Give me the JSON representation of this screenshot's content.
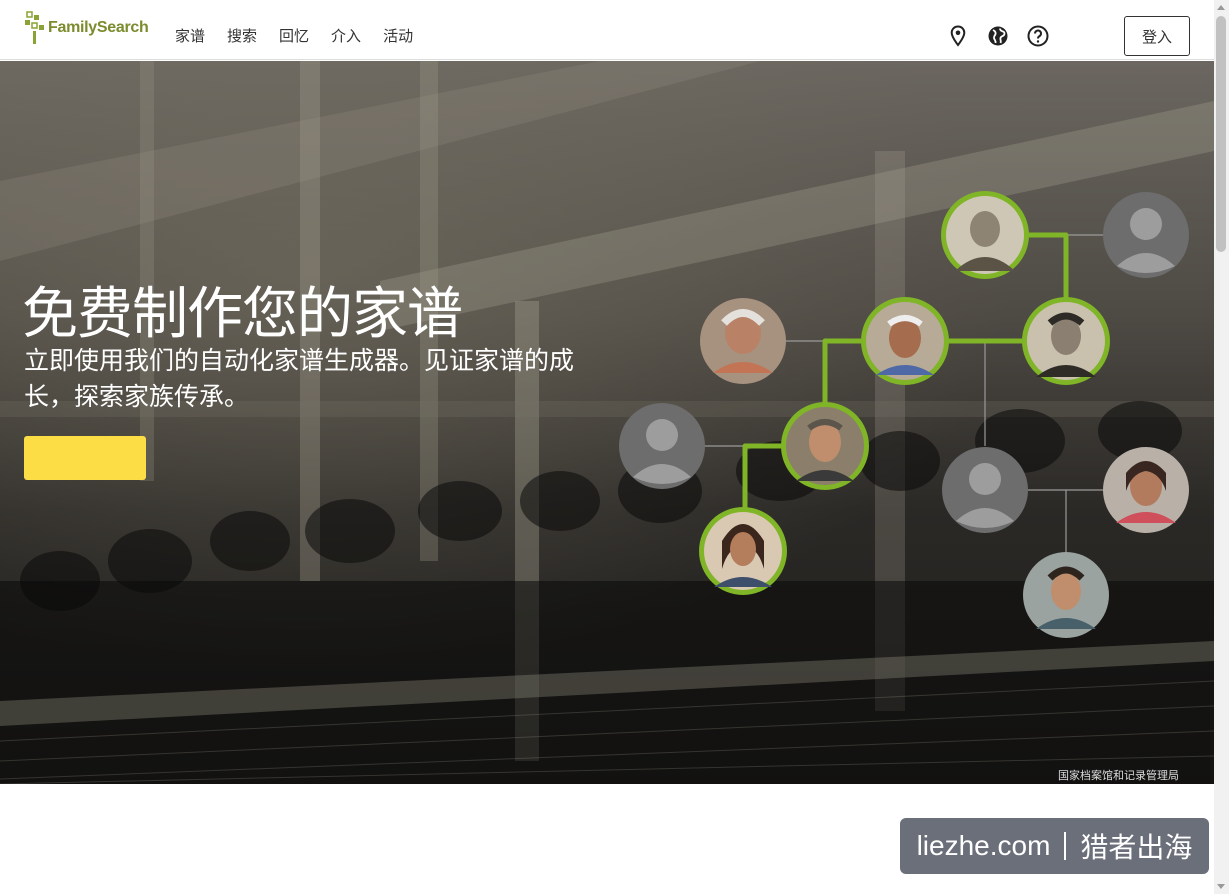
{
  "header": {
    "logo_text": "FamilySearch",
    "nav": [
      "家谱",
      "搜索",
      "回忆",
      "介入",
      "活动"
    ],
    "icons": [
      "location-pin-icon",
      "globe-icon",
      "help-icon"
    ],
    "login_label": "登入"
  },
  "hero": {
    "title": "免费制作您的家谱",
    "subtitle": "立即使用我们的自动化家谱生成器。见证家谱的成长，探索家族传承。",
    "cta_label": "",
    "photo_credit": "国家档案馆和记录管理局"
  },
  "watermark": {
    "left": "liezhe.com",
    "right": "猎者出海"
  },
  "colors": {
    "brand_green": "#7a8c2e",
    "tree_line_green": "#7fb526",
    "cta_yellow": "#fddd45"
  }
}
